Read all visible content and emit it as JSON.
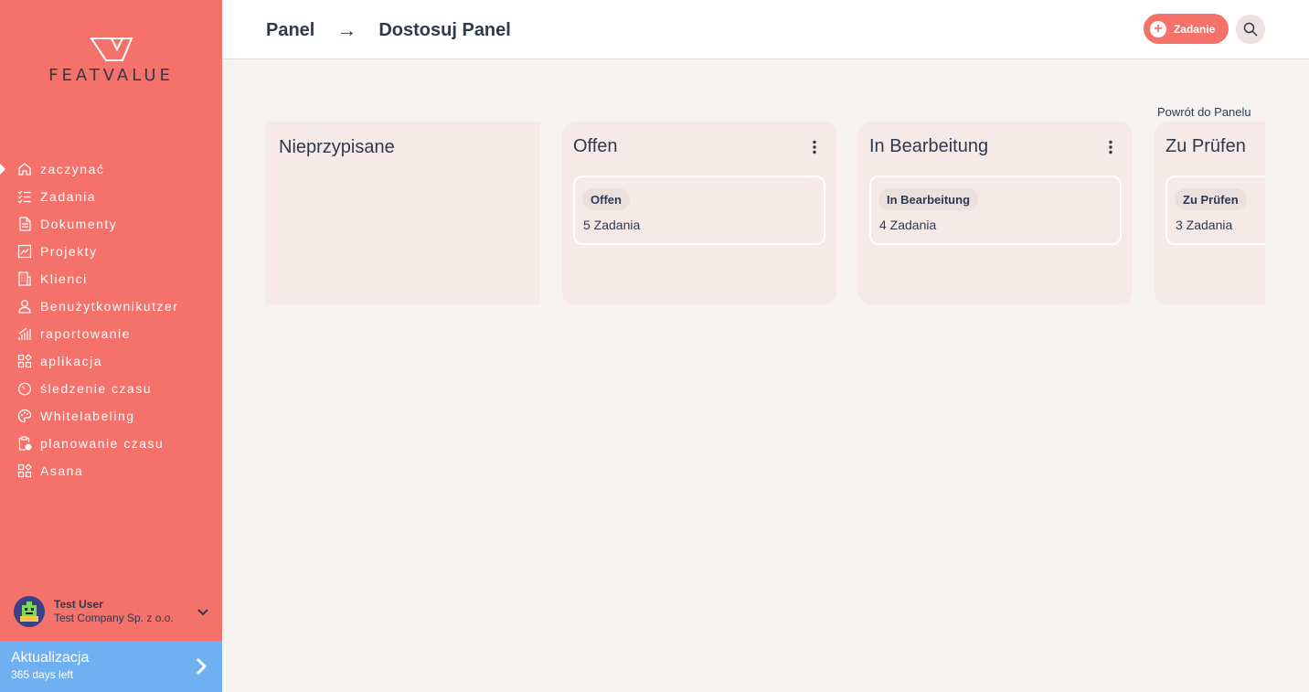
{
  "brand": {
    "name": "FEATVALUE"
  },
  "colors": {
    "sidebar": "#f4726a",
    "accent": "#f4726a",
    "upgrade": "#6fb0f0",
    "text": "#2e3a4f",
    "background": "#f7f3f2",
    "column": "#f5eae8"
  },
  "sidebar": {
    "items": [
      {
        "label": "zaczynać",
        "icon": "home-icon",
        "active": true
      },
      {
        "label": "Zadania",
        "icon": "tasks-icon"
      },
      {
        "label": "Dokumenty",
        "icon": "documents-icon"
      },
      {
        "label": "Projekty",
        "icon": "projects-icon"
      },
      {
        "label": "Klienci",
        "icon": "building-icon"
      },
      {
        "label": "Benużytkownikutzer",
        "icon": "user-icon"
      },
      {
        "label": "raportowanie",
        "icon": "chart-icon"
      },
      {
        "label": "aplikacja",
        "icon": "apps-icon"
      },
      {
        "label": "śledzenie czasu",
        "icon": "timer-icon"
      },
      {
        "label": "Whitelabeling",
        "icon": "palette-icon"
      },
      {
        "label": "planowanie czasu",
        "icon": "clipboard-clock-icon"
      },
      {
        "label": "Asana",
        "icon": "apps-icon"
      }
    ],
    "user": {
      "name": "Test User",
      "company": "Test Company Sp. z o.o."
    },
    "upgrade": {
      "title": "Aktualizacja",
      "subtitle": "365 days left"
    }
  },
  "header": {
    "breadcrumb": {
      "root": "Panel",
      "separator": "→",
      "current": "Dostosuj Panel"
    },
    "add_button": "Zadanie"
  },
  "main": {
    "back_link": "Powrót do Panelu",
    "columns": [
      {
        "title": "Nieprzypisane"
      },
      {
        "title": "Offen",
        "card": {
          "badge": "Offen",
          "count": "5 Zadania"
        }
      },
      {
        "title": "In Bearbeitung",
        "card": {
          "badge": "In Bearbeitung",
          "count": "4 Zadania"
        }
      },
      {
        "title": "Zu Prüfen",
        "card": {
          "badge": "Zu Prüfen",
          "count": "3 Zadania"
        }
      }
    ]
  }
}
